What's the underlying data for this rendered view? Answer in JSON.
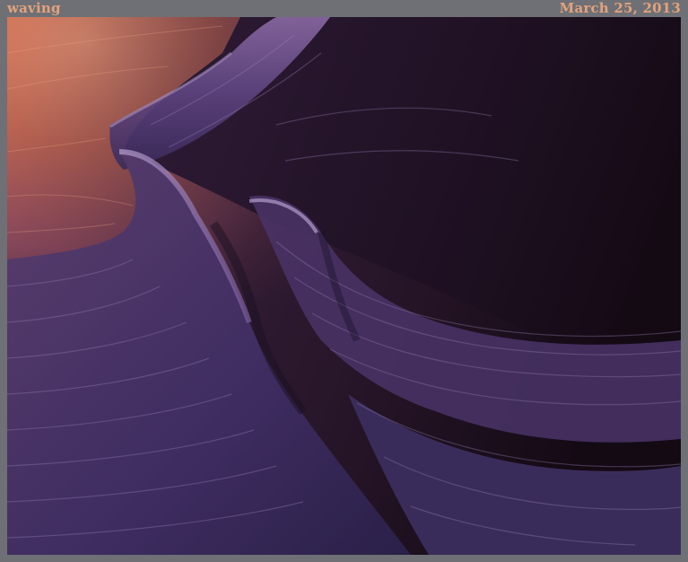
{
  "photo": {
    "title": "waving",
    "date": "March 25, 2013",
    "image_icon": "canyon-photo",
    "colors": {
      "frame": "#6e7075",
      "caption": "#e3a27c",
      "sandstone_warm": "#c86a52",
      "sandstone_violet": "#6a4a82",
      "shadow": "#1c0f1c"
    }
  }
}
